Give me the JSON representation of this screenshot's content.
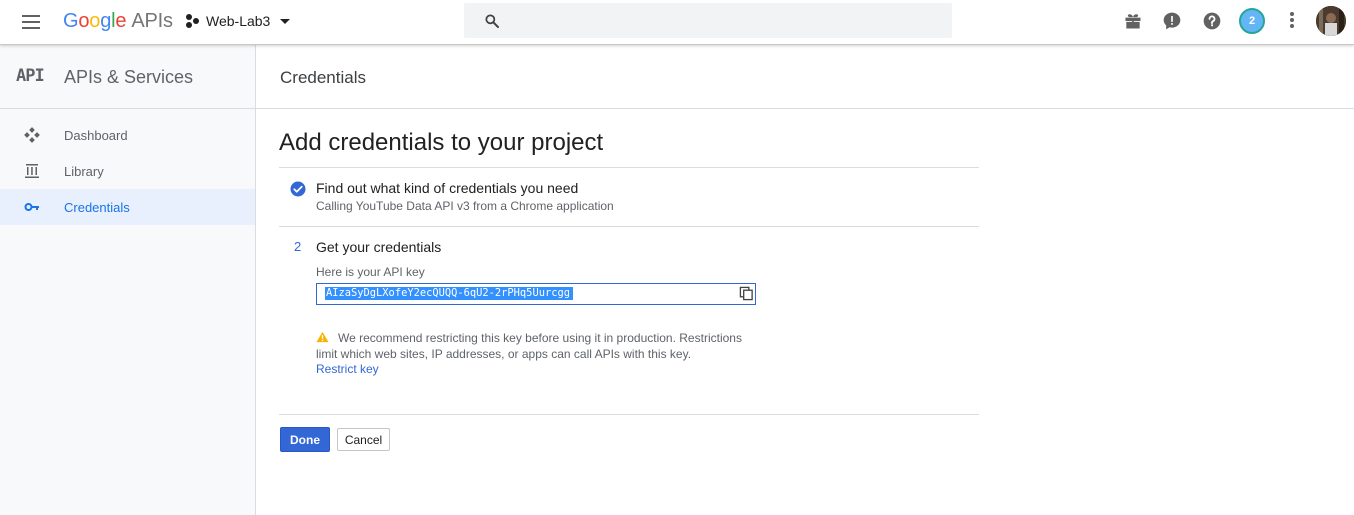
{
  "topbar": {
    "menu_icon": "hamburger-menu-icon",
    "logo": {
      "g1": "G",
      "o1": "o",
      "o2": "o",
      "g2": "g",
      "l": "l",
      "e": "e",
      "suffix": "APIs"
    },
    "project_name": "Web-Lab3",
    "search": {
      "placeholder": "",
      "icon": "search-icon"
    },
    "icons": [
      "gift-icon",
      "feedback-icon",
      "help-icon",
      "kebab-menu-icon"
    ],
    "notification_count": "2",
    "avatar": "user-avatar"
  },
  "sidebar": {
    "badge": "API",
    "title": "APIs & Services",
    "items": [
      {
        "label": "Dashboard",
        "icon": "dashboard-icon",
        "active": false
      },
      {
        "label": "Library",
        "icon": "library-icon",
        "active": false
      },
      {
        "label": "Credentials",
        "icon": "key-icon",
        "active": true
      }
    ]
  },
  "main": {
    "header_title": "Credentials",
    "page_title": "Add credentials to your project",
    "step1": {
      "title": "Find out what kind of credentials you need",
      "subtitle": "Calling YouTube Data API v3 from a Chrome application"
    },
    "step2": {
      "number": "2",
      "title": "Get your credentials",
      "key_label": "Here is your API key",
      "api_key": "AIzaSyDgLXofeY2ecQUQQ-6qU2-2rPHq5Uurcgg",
      "warning": "We recommend restricting this key before using it in production. Restrictions limit which web sites, IP addresses, or apps can call APIs with this key.",
      "restrict_link": "Restrict key"
    },
    "buttons": {
      "done": "Done",
      "cancel": "Cancel"
    }
  },
  "colors": {
    "primary": "#3367d6",
    "active_nav_bg": "#e8f0fe",
    "warning": "#f4b400"
  }
}
